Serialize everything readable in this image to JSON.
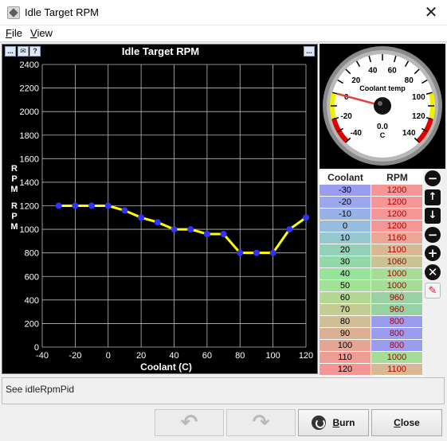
{
  "window": {
    "title": "Idle Target RPM",
    "close_glyph": "✕"
  },
  "menu": {
    "file": "File",
    "file_u": "F",
    "file_rest": "ile",
    "view_u": "V",
    "view_rest": "iew"
  },
  "chart_toolbar": {
    "menu_glyph": "...",
    "help_glyph": "?",
    "right_menu_glyph": "..."
  },
  "chart_data": {
    "type": "line",
    "title": "Idle Target RPM",
    "xlabel": "Coolant (C)",
    "ylabel": "RPM",
    "x": [
      -30,
      -20,
      -10,
      0,
      10,
      20,
      30,
      40,
      50,
      60,
      70,
      80,
      90,
      100,
      110,
      120
    ],
    "values": [
      1200,
      1200,
      1200,
      1200,
      1160,
      1100,
      1060,
      1000,
      1000,
      960,
      960,
      800,
      800,
      800,
      1000,
      1100
    ],
    "xlim": [
      -40,
      120
    ],
    "ylim": [
      0,
      2400
    ],
    "xticks": [
      -40,
      -20,
      0,
      20,
      40,
      60,
      80,
      100,
      120
    ],
    "yticks": [
      0,
      200,
      400,
      600,
      800,
      1000,
      1200,
      1400,
      1600,
      1800,
      2000,
      2200,
      2400
    ],
    "grid": true,
    "colors": {
      "line": "#ffff00",
      "points": "#3333ff",
      "grid": "#bbbbbb",
      "background": "#000000"
    }
  },
  "gauge": {
    "title": "Coolant temp",
    "value": "0.0",
    "units": "C",
    "ticks": [
      "-40",
      "-20",
      "0",
      "20",
      "40",
      "60",
      "80",
      "100",
      "120",
      "140"
    ],
    "min": -40,
    "max": 140,
    "current": 0
  },
  "table": {
    "headers": [
      "Coolant",
      "RPM"
    ],
    "rows": [
      {
        "coolant": "-30",
        "rpm": "1200",
        "c1": "#9a9cf0",
        "c2": "#f59696"
      },
      {
        "coolant": "-20",
        "rpm": "1200",
        "c1": "#9aa6ee",
        "c2": "#f59696"
      },
      {
        "coolant": "-10",
        "rpm": "1200",
        "c1": "#9ab0e8",
        "c2": "#f59696"
      },
      {
        "coolant": "0",
        "rpm": "1200",
        "c1": "#98bcde",
        "c2": "#f59696"
      },
      {
        "coolant": "10",
        "rpm": "1160",
        "c1": "#95c8cf",
        "c2": "#eda596"
      },
      {
        "coolant": "20",
        "rpm": "1100",
        "c1": "#92d0b8",
        "c2": "#d9b894"
      },
      {
        "coolant": "30",
        "rpm": "1060",
        "c1": "#92d8a8",
        "c2": "#c8c394"
      },
      {
        "coolant": "40",
        "rpm": "1000",
        "c1": "#96e49a",
        "c2": "#a4dc98"
      },
      {
        "coolant": "50",
        "rpm": "1000",
        "c1": "#a2e296",
        "c2": "#a4dc98"
      },
      {
        "coolant": "60",
        "rpm": "960",
        "c1": "#b4d894",
        "c2": "#98d2a4"
      },
      {
        "coolant": "70",
        "rpm": "960",
        "c1": "#c4cc94",
        "c2": "#98d2a4"
      },
      {
        "coolant": "80",
        "rpm": "800",
        "c1": "#d2be94",
        "c2": "#9a9cf0"
      },
      {
        "coolant": "90",
        "rpm": "800",
        "c1": "#dcb094",
        "c2": "#9a9cf0"
      },
      {
        "coolant": "100",
        "rpm": "800",
        "c1": "#e6a494",
        "c2": "#9a9cf0"
      },
      {
        "coolant": "110",
        "rpm": "1000",
        "c1": "#ee9c96",
        "c2": "#a4dc98"
      },
      {
        "coolant": "120",
        "rpm": "1100",
        "c1": "#f59696",
        "c2": "#d9b894"
      }
    ]
  },
  "side_buttons": {
    "collapse": "−",
    "up": "↑",
    "down": "↓",
    "decrease": "−",
    "increase": "+",
    "cancel": "✕",
    "edit": "✎"
  },
  "note": "See idleRpmPid",
  "buttons": {
    "undo": "↶",
    "redo": "↷",
    "burn": "Burn",
    "burn_u": "B",
    "burn_rest": "urn",
    "close": "Close",
    "close_u": "C",
    "close_rest": "lose"
  }
}
